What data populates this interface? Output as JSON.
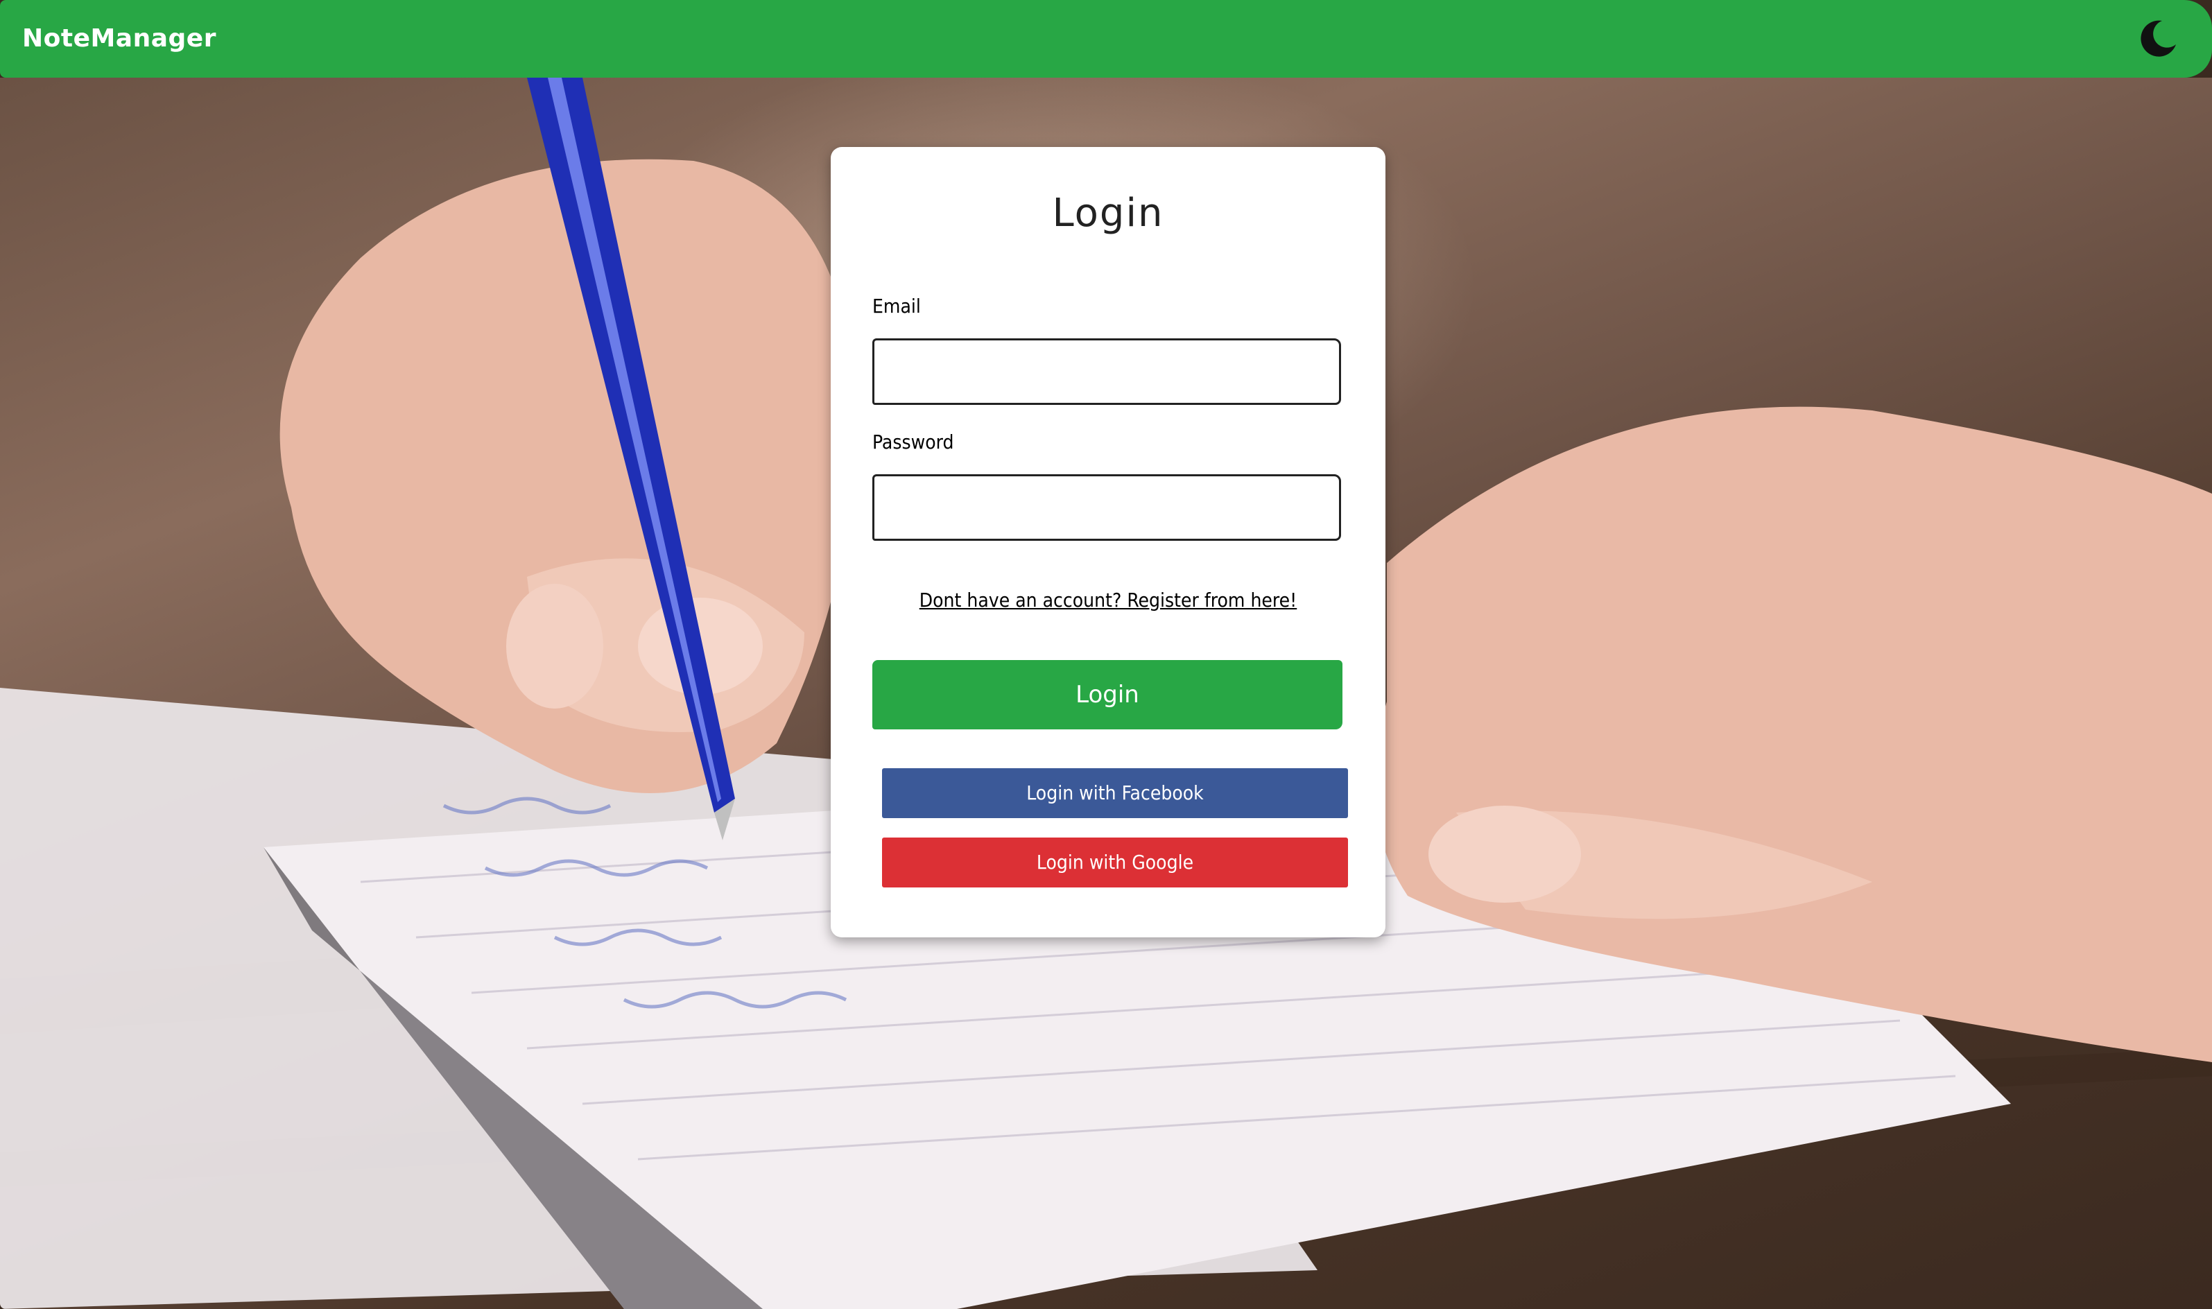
{
  "navbar": {
    "brand": "NoteManager",
    "theme_toggle_icon": "moon-icon"
  },
  "login_card": {
    "title": "Login",
    "email": {
      "label": "Email",
      "value": "",
      "placeholder": ""
    },
    "password": {
      "label": "Password",
      "value": "",
      "placeholder": ""
    },
    "register_link": "Dont have an account? Register from here!",
    "login_button": "Login",
    "facebook_button": "Login with Facebook",
    "google_button": "Login with Google"
  },
  "background": {
    "image": "photo-hand-writing-in-notebook-with-blue-pen"
  },
  "colors": {
    "primary_green": "#28a745",
    "facebook_blue": "#3b5998",
    "google_red": "#dc3035",
    "card_background": "#ffffff",
    "text_dark": "#222222"
  }
}
